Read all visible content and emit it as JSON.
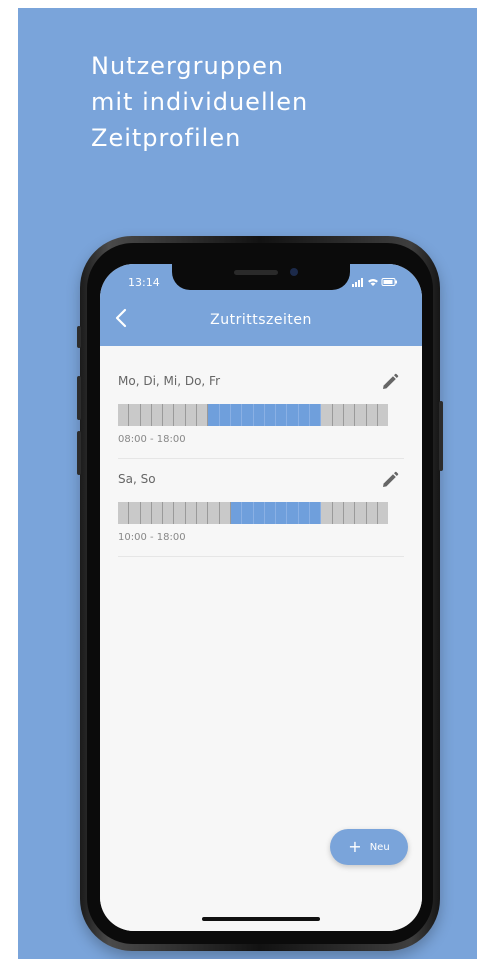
{
  "headline": {
    "line1": "Nutzergruppen",
    "line2": "mit individuellen",
    "line3": "Zeitprofilen"
  },
  "colors": {
    "accent": "#7aa4da",
    "bar_active": "#6f9fdc",
    "bar_inactive": "#c9c9c9"
  },
  "status_bar": {
    "time": "13:14",
    "icons": "signal wifi battery"
  },
  "app_bar": {
    "back_icon": "chevron-left-icon",
    "title": "Zutrittszeiten"
  },
  "schedules": [
    {
      "days": "Mo, Di, Mi, Do, Fr",
      "time_range": "08:00 - 18:00",
      "segments": 24,
      "active_from": 8,
      "active_to": 18,
      "edit_icon": "pencil-icon"
    },
    {
      "days": "Sa, So",
      "time_range": "10:00 - 18:00",
      "segments": 24,
      "active_from": 10,
      "active_to": 18,
      "edit_icon": "pencil-icon"
    }
  ],
  "fab": {
    "label": "Neu",
    "icon": "plus-icon"
  }
}
